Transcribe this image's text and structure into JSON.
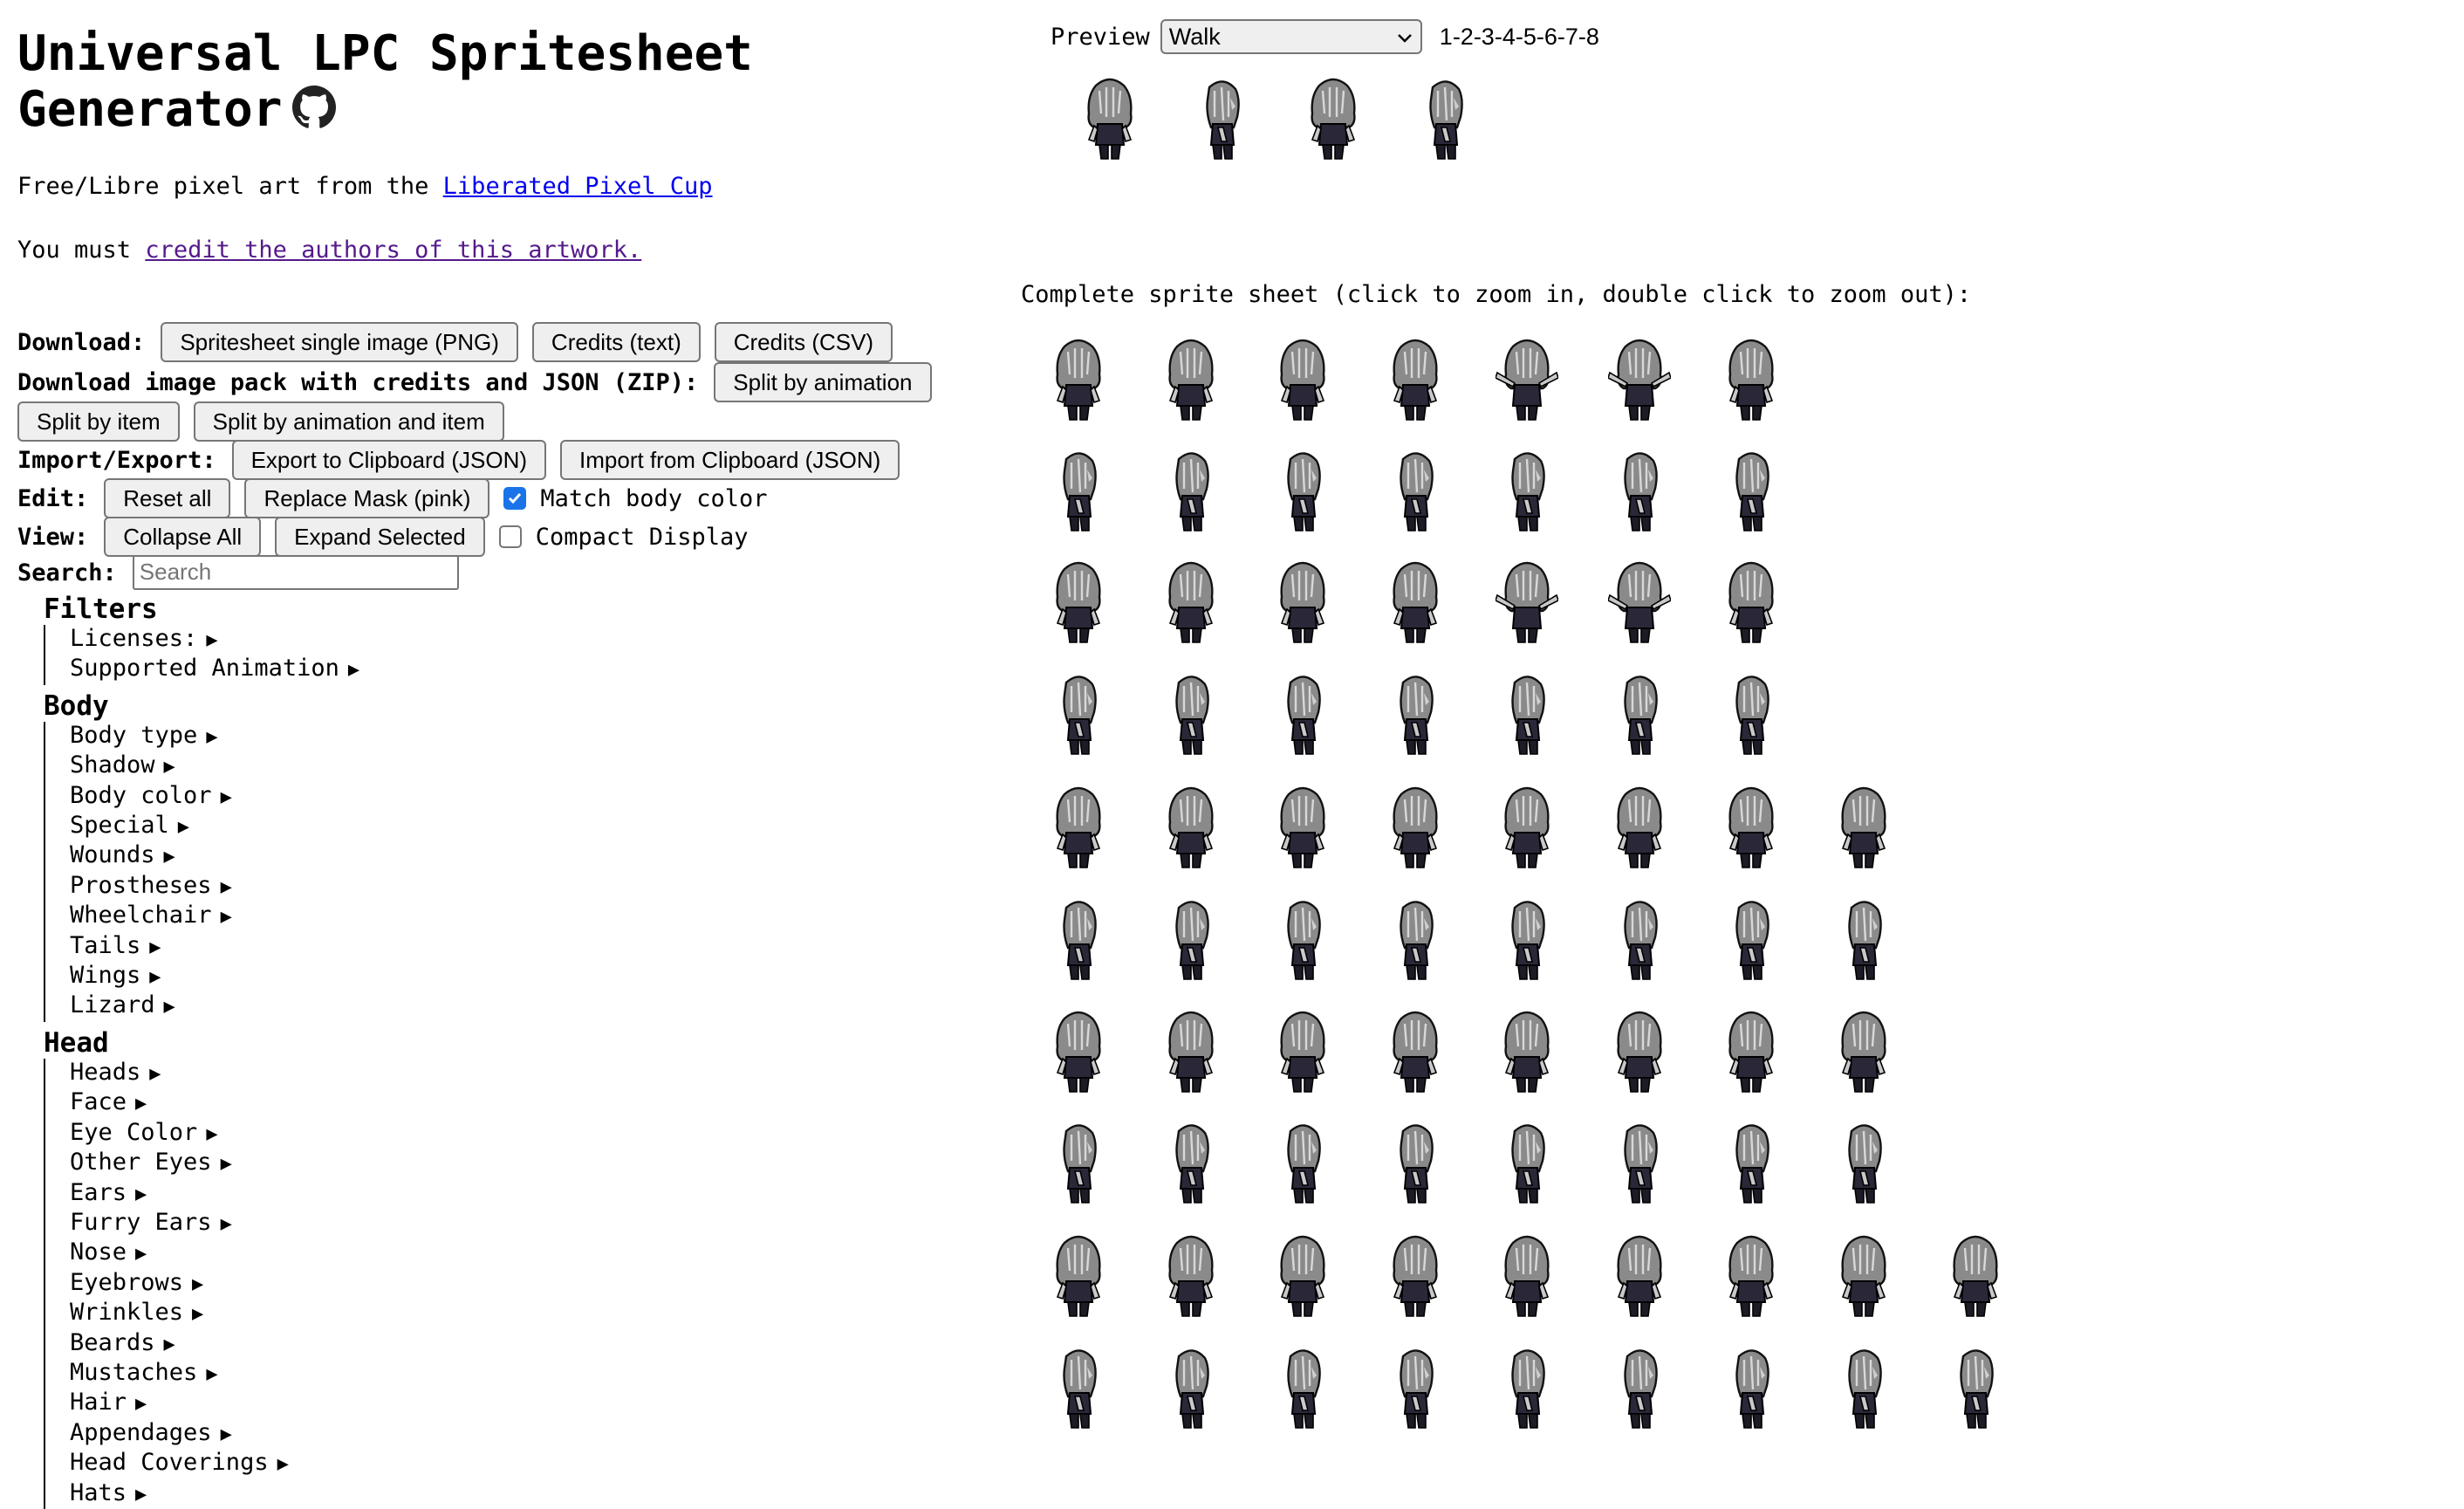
{
  "header": {
    "title_line1": "Universal LPC Spritesheet",
    "title_line2": "Generator",
    "github_icon": "github-icon"
  },
  "intro": {
    "free_prefix": "Free/Libre pixel art from the ",
    "lpc_link": "Liberated Pixel Cup",
    "must_prefix": "You must ",
    "credit_link": "credit the authors of this artwork."
  },
  "download": {
    "label": "Download:",
    "png": "Spritesheet single image (PNG)",
    "credits_text": "Credits (text)",
    "credits_csv": "Credits (CSV)"
  },
  "zip": {
    "label": "Download image pack with credits and JSON (ZIP):",
    "by_animation": "Split by animation",
    "by_item": "Split by item",
    "by_anim_item": "Split by animation and item"
  },
  "import_export": {
    "label": "Import/Export:",
    "export": "Export to Clipboard (JSON)",
    "import": "Import from Clipboard (JSON)"
  },
  "edit": {
    "label": "Edit:",
    "reset": "Reset all",
    "replace_mask": "Replace Mask (pink)",
    "match_body_color": "Match body color",
    "match_body_checked": true
  },
  "view": {
    "label": "View:",
    "collapse": "Collapse All",
    "expand": "Expand Selected",
    "compact": "Compact Display",
    "compact_checked": false
  },
  "search": {
    "label": "Search:",
    "placeholder": "Search"
  },
  "tree": {
    "filters": {
      "title": "Filters",
      "items": [
        "Licenses:",
        "Supported Animation"
      ]
    },
    "body": {
      "title": "Body",
      "items": [
        "Body type",
        "Shadow",
        "Body color",
        "Special",
        "Wounds",
        "Prostheses",
        "Wheelchair",
        "Tails",
        "Wings",
        "Lizard"
      ]
    },
    "head": {
      "title": "Head",
      "items": [
        "Heads",
        "Face",
        "Eye Color",
        "Other Eyes",
        "Ears",
        "Furry Ears",
        "Nose",
        "Eyebrows",
        "Wrinkles",
        "Beards",
        "Mustaches",
        "Hair",
        "Appendages",
        "Head Coverings",
        "Hats"
      ]
    },
    "arrow": "▶"
  },
  "preview": {
    "label": "Preview",
    "animation": "Walk",
    "frames": "1-2-3-4-5-6-7-8"
  },
  "sheet": {
    "title": "Complete sprite sheet (click to zoom in, double click to zoom out):",
    "row_counts": [
      7,
      7,
      7,
      7,
      8,
      8,
      8,
      8,
      9,
      9
    ]
  },
  "colors": {
    "link": "#0000ee",
    "visited": "#551a8b",
    "checkbox": "#1a73e8"
  }
}
